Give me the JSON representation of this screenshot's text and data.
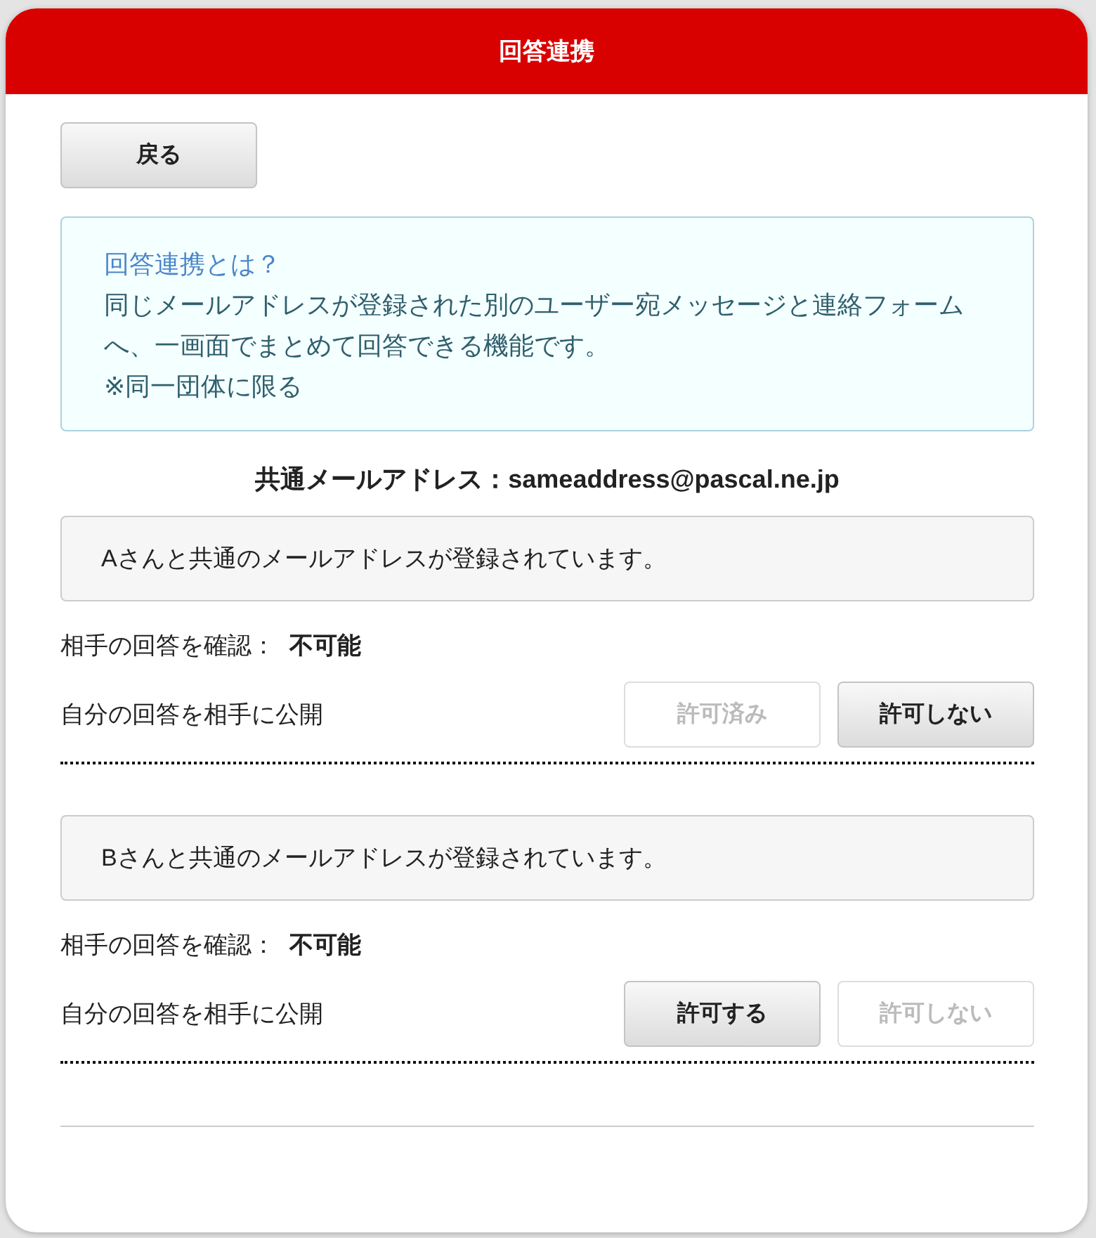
{
  "header": {
    "title": "回答連携"
  },
  "back_button": {
    "label": "戻る"
  },
  "info": {
    "title": "回答連携とは？",
    "body": "同じメールアドレスが登録された別のユーザー宛メッセージと連絡フォームへ、一画面でまとめて回答できる機能です。",
    "note": "※同一団体に限る"
  },
  "common_address": "共通メールアドレス：sameaddress@pascal.ne.jp",
  "links": [
    {
      "message": "Aさんと共通のメールアドレスが登録されています。",
      "check_label": "相手の回答を確認：",
      "check_value": "不可能",
      "publish_label": "自分の回答を相手に公開",
      "buttons": [
        {
          "label": "許可済み",
          "disabled": true
        },
        {
          "label": "許可しない",
          "disabled": false
        }
      ]
    },
    {
      "message": "Bさんと共通のメールアドレスが登録されています。",
      "check_label": "相手の回答を確認：",
      "check_value": "不可能",
      "publish_label": "自分の回答を相手に公開",
      "buttons": [
        {
          "label": "許可する",
          "disabled": false
        },
        {
          "label": "許可しない",
          "disabled": true
        }
      ]
    }
  ]
}
